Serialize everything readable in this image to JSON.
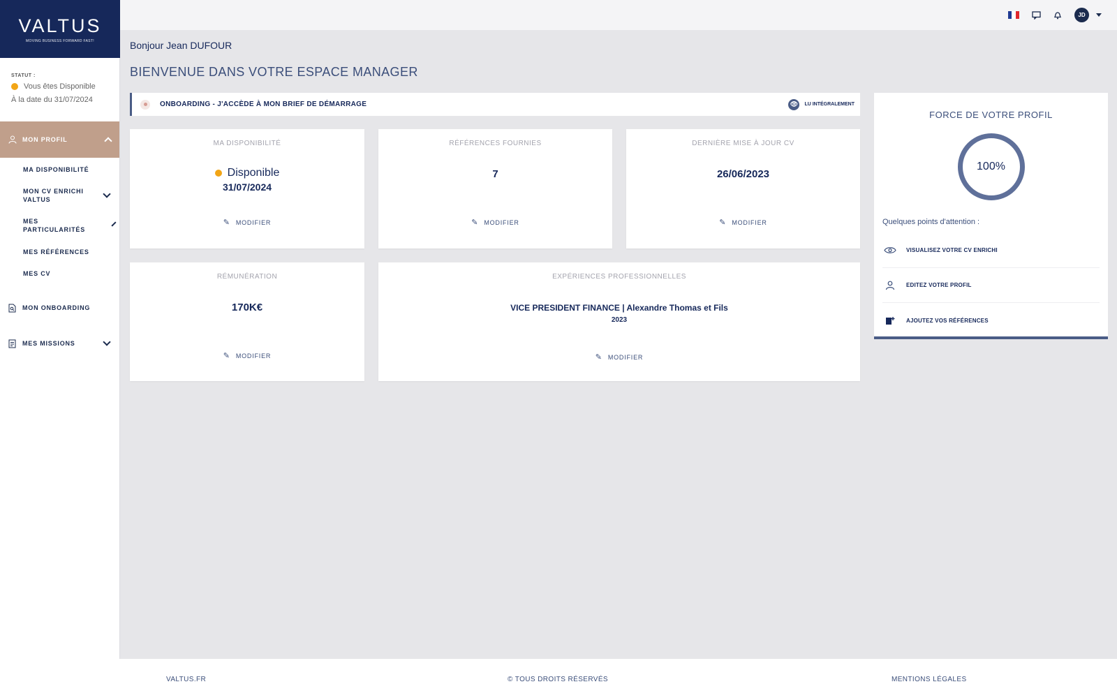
{
  "brand": {
    "logo": "VALTUS",
    "tagline": "MOVING BUSINESS FORWARD FAST!"
  },
  "status": {
    "label": "STATUT :",
    "value": "Vous êtes Disponible",
    "date": "À la date du 31/07/2024",
    "dot_color": "#f2a516"
  },
  "nav": {
    "profile": "MON PROFIL",
    "sub": {
      "availability": "MA DISPONIBILITÉ",
      "cv_enriched": "MON CV ENRICHI VALTUS",
      "particularities": "MES PARTICULARITÉS",
      "references": "MES RÉFÉRENCES",
      "cv": "MES CV"
    },
    "onboarding": "MON ONBOARDING",
    "missions": "MES MISSIONS"
  },
  "topbar": {
    "avatar": "JD",
    "icons": [
      "flag-fr-icon",
      "chat-icon",
      "bell-icon"
    ]
  },
  "greeting": "Bonjour Jean DUFOUR",
  "welcome": "BIENVENUE DANS VOTRE ESPACE MANAGER",
  "onboarding_bar": {
    "text": "ONBOARDING  -  J'ACCÈDE À MON BRIEF DE DÉMARRAGE",
    "status": "LU INTÉGRALEMENT"
  },
  "cards": {
    "availability": {
      "title": "MA DISPONIBILITÉ",
      "status": "Disponible",
      "date": "31/07/2024"
    },
    "references": {
      "title": "RÉFÉRENCES FOURNIES",
      "value": "7"
    },
    "cv_update": {
      "title": "DERNIÈRE MISE À JOUR CV",
      "value": "26/06/2023"
    },
    "salary": {
      "title": "RÉMUNÉRATION",
      "value": "170K€"
    },
    "experience": {
      "title": "EXPÉRIENCES PROFESSIONNELLES",
      "role": "VICE PRESIDENT FINANCE | Alexandre Thomas et Fils",
      "year": "2023"
    },
    "modify_label": "MODIFIER"
  },
  "profile_strength": {
    "title": "FORCE DE VOTRE PROFIL",
    "percent": "100%",
    "attention_label": "Quelques points d'attention :",
    "items": [
      "VISUALISEZ VOTRE CV ENRICHI",
      "EDITEZ VOTRE PROFIL",
      "AJOUTEZ VOS RÉFÉRENCES"
    ]
  },
  "footer": {
    "left": "VALTUS.FR",
    "center": "© TOUS DROITS RÉSERVÉS",
    "right": "MENTIONS LÉGALES"
  },
  "colors": {
    "navy": "#16285a",
    "accent": "#c09f8b",
    "available": "#f2a516"
  }
}
